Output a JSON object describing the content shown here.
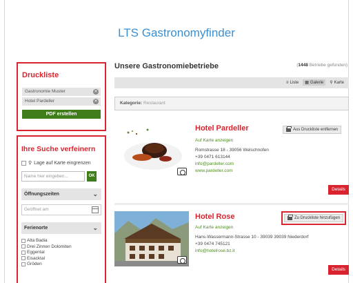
{
  "app": {
    "title": "LTS Gastronomyfinder"
  },
  "druckliste": {
    "title": "Druckliste",
    "items": [
      {
        "label": "Gastronomie Muster"
      },
      {
        "label": "Hotel Pardeller"
      }
    ],
    "remove_glyph": "✕",
    "pdf_button": "PDF erstellen"
  },
  "filter": {
    "title": "Ihre Suche verfeinern",
    "map_checkbox": "Lage auf Karte eingrenzen",
    "search_placeholder": "Name hier eingeben...",
    "ok_button": "OK",
    "opening_hours": {
      "label": "Öffnungszeiten",
      "placeholder": "Geöffnet am"
    },
    "ferienorte": {
      "label": "Ferienorte",
      "items": [
        "Alta Badia",
        "Drei Zinnen Dolomiten",
        "Eggental",
        "Eisacktal",
        "Gröden"
      ]
    }
  },
  "main": {
    "title": "Unsere Gastronomiebetriebe",
    "count_number": "1448",
    "count_suffix": "Betriebe gefunden)",
    "count_prefix": "(",
    "views": [
      {
        "icon": "list-icon",
        "glyph": "≡",
        "label": "Liste"
      },
      {
        "icon": "grid-icon",
        "glyph": "▦",
        "label": "Galerie"
      },
      {
        "icon": "map-pin-icon",
        "glyph": "⚲",
        "label": "Karte"
      }
    ],
    "category_label": "Kategorie:",
    "category_value": "Restaurant"
  },
  "hotels": [
    {
      "name": "Hotel Pardeller",
      "map_link": "Auf Karte anzeigen",
      "address": "Romstrasse 18 - 39056 Welschnofen",
      "phone": "+39 0471 613144",
      "email": "info@pardeller.com",
      "web": "www.pardeller.com",
      "print_action": "Aus Druckliste entfernen",
      "details": "Details"
    },
    {
      "name": "Hotel Rose",
      "map_link": "Auf Karte anzeigen",
      "address": "Hans-Wassermann-Strasse 10 - 39039 39039 Niederdorf",
      "phone": "+39 0474 745121",
      "email": "info@hotelrose.bz.it",
      "print_action": "Zu Druckliste hinzufügen",
      "details": "Details"
    }
  ],
  "colors": {
    "accent_red": "#d9232e",
    "accent_green": "#3f7d1a",
    "title_blue": "#3a8fd1"
  }
}
